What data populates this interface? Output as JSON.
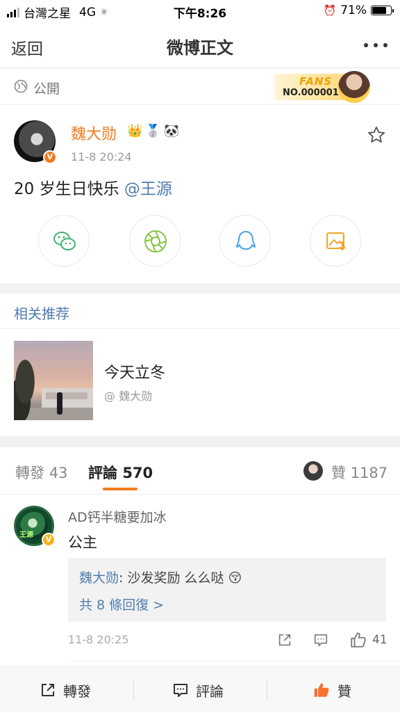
{
  "status_bar": {
    "carrier": "台灣之星",
    "network": "4G",
    "time": "下午8:26",
    "battery": "71%"
  },
  "nav": {
    "back_label": "返回",
    "title": "微博正文"
  },
  "visibility": {
    "label": "公開"
  },
  "fans_badge": {
    "title": "FANS",
    "number": "NO.000001"
  },
  "post": {
    "author": "魏大勋",
    "verified_mark": "V",
    "time": "11-8 20:24",
    "text": "20 岁生日快乐",
    "mention": "@王源",
    "badges": [
      "👑",
      "🥈",
      "🐼"
    ]
  },
  "share_buttons": [
    {
      "name": "wechat",
      "color": "#3bb273"
    },
    {
      "name": "moments",
      "color": "#8bc34a"
    },
    {
      "name": "qq",
      "color": "#4aa3e0"
    },
    {
      "name": "save-image",
      "color": "#f0a52d"
    }
  ],
  "related": {
    "section_title": "相关推荐",
    "item_title": "今天立冬",
    "item_author": "@ 魏大勋"
  },
  "tabs": {
    "repost_label": "轉發",
    "repost_count": "43",
    "comment_label": "評論",
    "comment_count": "570",
    "like_label": "贊",
    "like_count": "1187"
  },
  "comment": {
    "user": "AD钙半糖要加冰",
    "avatar_text": "王源",
    "verified_mark": "V",
    "text": "公主",
    "reply_user": "魏大勋",
    "reply_text": ": 沙发奖励 么么哒",
    "reply_emoji": "😚",
    "more_replies": "共 8 條回復 >",
    "time": "11-8 20:25",
    "like_count": "41"
  },
  "bottom_bar": {
    "repost": "轉發",
    "comment": "評論",
    "like": "贊"
  },
  "colors": {
    "accent_orange": "#f47a1f",
    "link_blue": "#507daf",
    "like_orange": "#f6702e"
  }
}
